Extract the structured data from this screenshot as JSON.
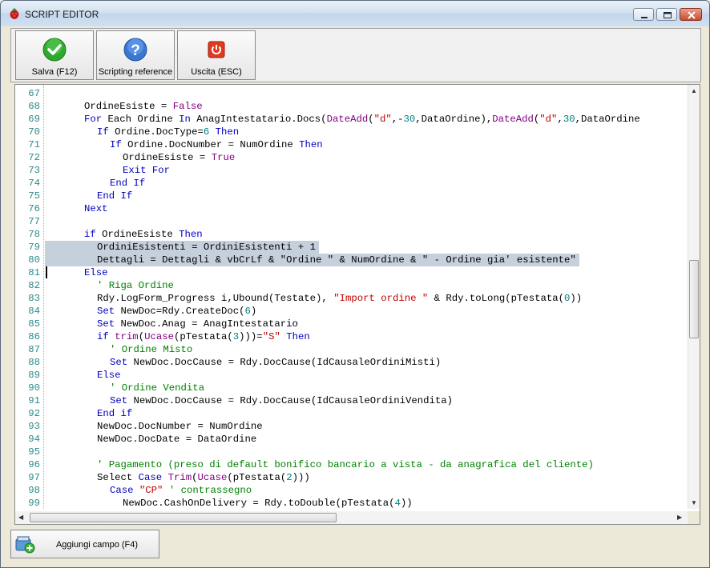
{
  "window": {
    "title": "SCRIPT EDITOR"
  },
  "toolbar": {
    "buttons": [
      {
        "label": "Salva (F12)",
        "icon": "check-icon"
      },
      {
        "label": "Scripting reference",
        "icon": "help-icon"
      },
      {
        "label": "Uscita (ESC)",
        "icon": "power-icon"
      }
    ]
  },
  "editor": {
    "lines": [
      {
        "n": "67",
        "indent": 0,
        "html": ""
      },
      {
        "n": "68",
        "indent": 0,
        "html": "OrdineEsiste = <span class=\"fn\">False</span>"
      },
      {
        "n": "69",
        "indent": 0,
        "html": "<span class=\"kw\">For</span> Each Ordine <span class=\"kw\">In</span> AnagIntestatario.Docs(<span class=\"fn\">DateAdd</span>(<span class=\"str\">\"d\"</span>,-<span class=\"num\">30</span>,DataOrdine),<span class=\"fn\">DateAdd</span>(<span class=\"str\">\"d\"</span>,<span class=\"num\">30</span>,DataOrdine"
      },
      {
        "n": "70",
        "indent": 1,
        "html": "<span class=\"kw\">If</span> Ordine.DocType=<span class=\"num\">6</span> <span class=\"kw\">Then</span>"
      },
      {
        "n": "71",
        "indent": 2,
        "html": "<span class=\"kw\">If</span> Ordine.DocNumber = NumOrdine <span class=\"kw\">Then</span>"
      },
      {
        "n": "72",
        "indent": 3,
        "html": "OrdineEsiste = <span class=\"fn\">True</span>"
      },
      {
        "n": "73",
        "indent": 3,
        "html": "<span class=\"kw\">Exit For</span>"
      },
      {
        "n": "74",
        "indent": 2,
        "html": "<span class=\"kw\">End If</span>"
      },
      {
        "n": "75",
        "indent": 1,
        "html": "<span class=\"kw\">End If</span>"
      },
      {
        "n": "76",
        "indent": 0,
        "html": "<span class=\"kw\">Next</span>"
      },
      {
        "n": "77",
        "indent": 0,
        "html": ""
      },
      {
        "n": "78",
        "indent": 0,
        "html": "<span class=\"kw\">if</span> OrdineEsiste <span class=\"kw\">Then</span>"
      },
      {
        "n": "79",
        "indent": 1,
        "html": "OrdiniEsistenti = OrdiniEsistenti + 1",
        "sel": true
      },
      {
        "n": "80",
        "indent": 1,
        "html": "Dettagli = Dettagli &amp; vbCrLf &amp; \"Ordine \" &amp; NumOrdine &amp; \" - Ordine gia' esistente\"",
        "sel": true
      },
      {
        "n": "81",
        "indent": 0,
        "html": "<span class=\"kw\">Else</span>"
      },
      {
        "n": "82",
        "indent": 1,
        "html": "<span class=\"cmt\">' Riga Ordine</span>"
      },
      {
        "n": "83",
        "indent": 1,
        "html": "Rdy.LogForm_Progress i,Ubound(Testate), <span class=\"str\">\"Import ordine \"</span> &amp; Rdy.toLong(pTestata(<span class=\"num\">0</span>))"
      },
      {
        "n": "84",
        "indent": 1,
        "html": "<span class=\"kw\">Set</span> NewDoc=Rdy.CreateDoc(<span class=\"num\">6</span>)"
      },
      {
        "n": "85",
        "indent": 1,
        "html": "<span class=\"kw\">Set</span> NewDoc.Anag = AnagIntestatario"
      },
      {
        "n": "86",
        "indent": 1,
        "html": "<span class=\"kw\">if</span> <span class=\"fn\">trim</span>(<span class=\"fn\">Ucase</span>(pTestata(<span class=\"num\">3</span>)))=<span class=\"str\">\"S\"</span> <span class=\"kw\">Then</span>"
      },
      {
        "n": "87",
        "indent": 2,
        "html": "<span class=\"cmt\">' Ordine Misto</span>"
      },
      {
        "n": "88",
        "indent": 2,
        "html": "<span class=\"kw\">Set</span> NewDoc.DocCause = Rdy.DocCause(IdCausaleOrdiniMisti)"
      },
      {
        "n": "89",
        "indent": 1,
        "html": "<span class=\"kw\">Else</span>"
      },
      {
        "n": "90",
        "indent": 2,
        "html": "<span class=\"cmt\">' Ordine Vendita</span>"
      },
      {
        "n": "91",
        "indent": 2,
        "html": "<span class=\"kw\">Set</span> NewDoc.DocCause = Rdy.DocCause(IdCausaleOrdiniVendita)"
      },
      {
        "n": "92",
        "indent": 1,
        "html": "<span class=\"kw\">End if</span>"
      },
      {
        "n": "93",
        "indent": 1,
        "html": "NewDoc.DocNumber = NumOrdine"
      },
      {
        "n": "94",
        "indent": 1,
        "html": "NewDoc.DocDate = DataOrdine"
      },
      {
        "n": "95",
        "indent": 0,
        "html": ""
      },
      {
        "n": "96",
        "indent": 1,
        "html": "<span class=\"cmt\">' Pagamento (preso di default bonifico bancario a vista - da anagrafica del cliente)</span>"
      },
      {
        "n": "97",
        "indent": 1,
        "html": "Select <span class=\"kw\">Case</span> <span class=\"fn\">Trim</span>(<span class=\"fn\">Ucase</span>(pTestata(<span class=\"num\">2</span>)))"
      },
      {
        "n": "98",
        "indent": 2,
        "html": "<span class=\"kw\">Case</span> <span class=\"str\">\"CP\"</span> <span class=\"cmt\">' contrassegno</span>"
      },
      {
        "n": "99",
        "indent": 3,
        "html": "NewDoc.CashOnDelivery = Rdy.toDouble(pTestata(<span class=\"num\">4</span>))"
      }
    ]
  },
  "footer": {
    "add_field_label": "Aggiungi campo (F4)",
    "add_field_icon": "add-field-icon"
  }
}
